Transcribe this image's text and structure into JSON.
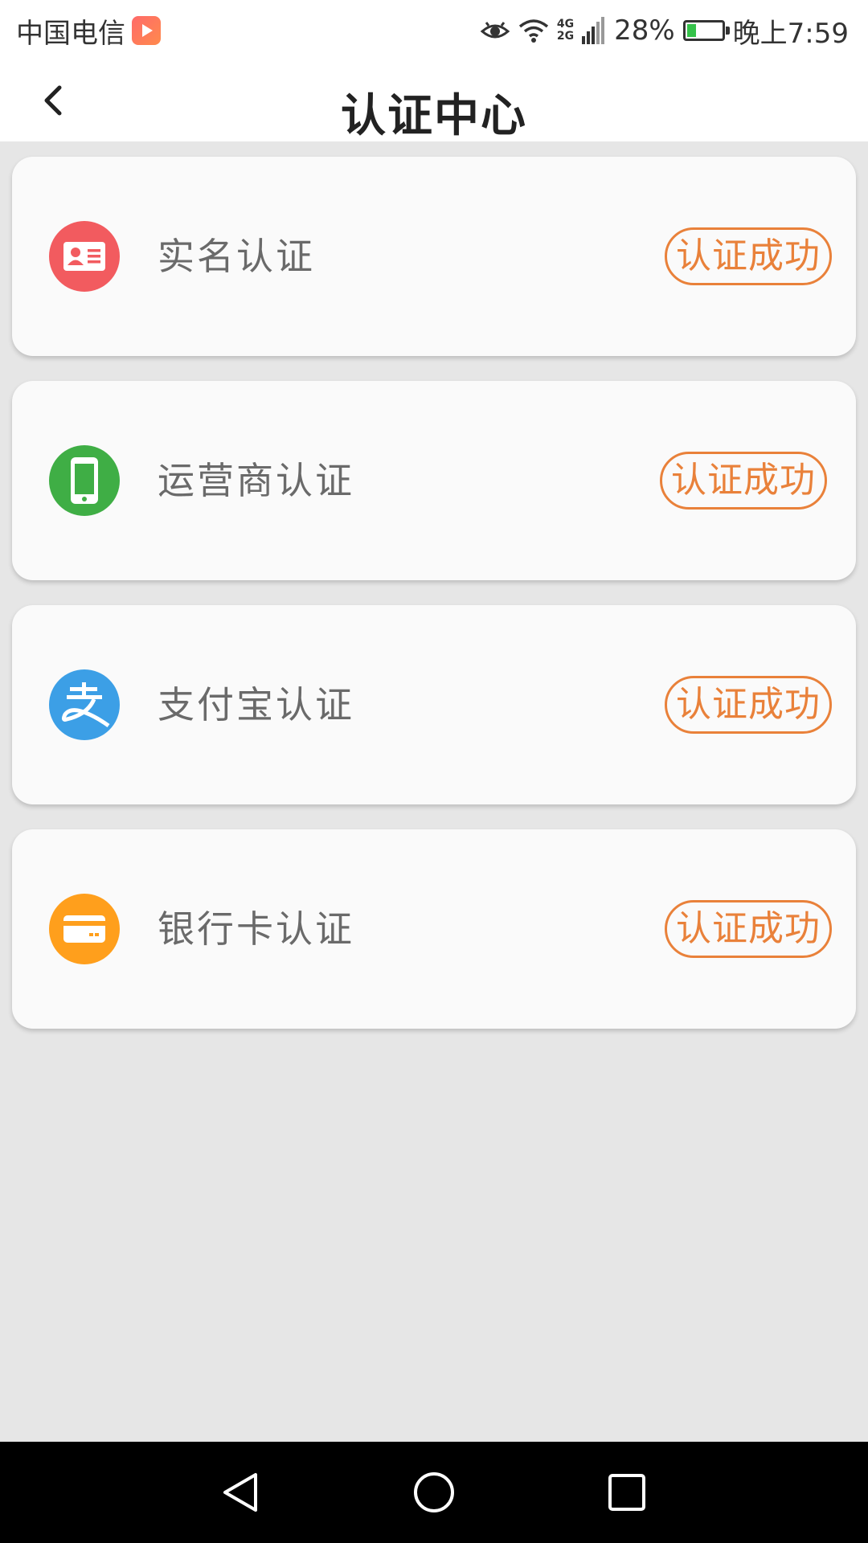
{
  "status_bar": {
    "carrier": "中国电信",
    "network_top": "4G",
    "network_bottom": "2G",
    "battery_percent": "28%",
    "battery_level": 0.28,
    "time": "晚上7:59"
  },
  "header": {
    "title": "认证中心"
  },
  "cards": [
    {
      "label": "实名认证",
      "status": "认证成功",
      "icon": "id-card-icon",
      "color": "#f25b5f"
    },
    {
      "label": "运营商认证",
      "status": "认证成功",
      "icon": "phone-icon",
      "color": "#3fae45"
    },
    {
      "label": "支付宝认证",
      "status": "认证成功",
      "icon": "alipay-icon",
      "color": "#3c9fe6"
    },
    {
      "label": "银行卡认证",
      "status": "认证成功",
      "icon": "bank-card-icon",
      "color": "#ff9f1c"
    }
  ],
  "colors": {
    "accent": "#e9813a",
    "background": "#e6e6e6",
    "card": "#fafafa"
  }
}
